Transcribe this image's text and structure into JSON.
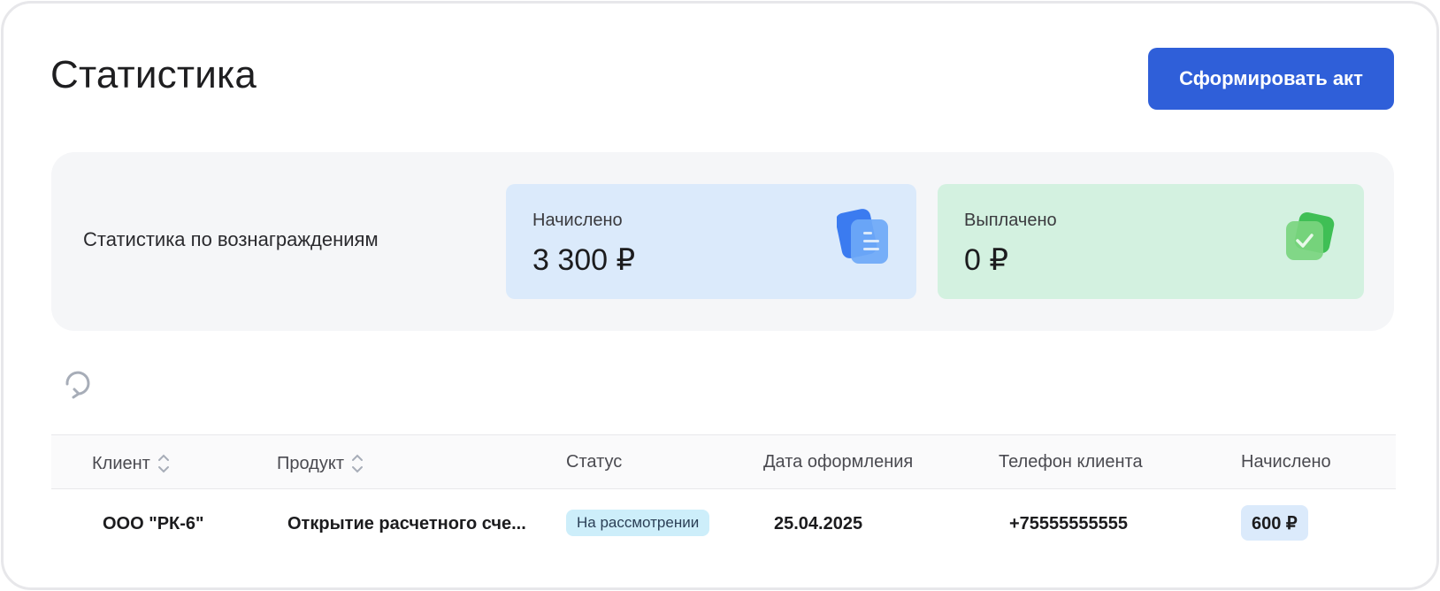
{
  "header": {
    "title": "Статистика",
    "act_button": "Сформировать акт"
  },
  "stats": {
    "label": "Статистика по вознаграждениям",
    "accrued": {
      "caption": "Начислено",
      "value": "3 300 ₽",
      "icon": "documents-icon",
      "color": "#dbeafb"
    },
    "paid": {
      "caption": "Выплачено",
      "value": "0 ₽",
      "icon": "check-badge-icon",
      "color": "#d3f1e0"
    }
  },
  "toolbar": {
    "refresh_icon": "refresh-icon"
  },
  "table": {
    "columns": [
      "Клиент",
      "Продукт",
      "Статус",
      "Дата оформления",
      "Телефон клиента",
      "Начислено"
    ],
    "rows": [
      {
        "client": "ООО \"РК-6\"",
        "product": "Открытие расчетного сче...",
        "status": "На рассмотрении",
        "date": "25.04.2025",
        "phone": "+75555555555",
        "accrued": "600 ₽"
      }
    ]
  },
  "colors": {
    "accent": "#2f5fd9",
    "status_badge": "#cdeefa",
    "accrued_card": "#dbeafb",
    "paid_card": "#d3f1e0"
  }
}
